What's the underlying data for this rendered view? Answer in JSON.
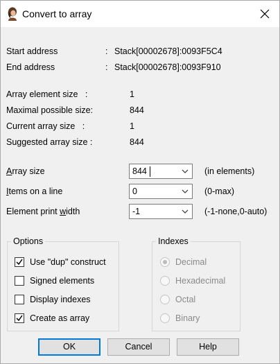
{
  "window": {
    "title": "Convert to array",
    "close_glyph": "✕"
  },
  "addresses": [
    {
      "label": "Start address",
      "sep": ":",
      "value": "Stack[00002678]:0093F5C4"
    },
    {
      "label": "End address",
      "sep": ":",
      "value": "Stack[00002678]:0093F910"
    }
  ],
  "info": [
    {
      "label": "Array element size   :",
      "value": "1"
    },
    {
      "label": "Maximal possible size:",
      "value": "844"
    },
    {
      "label": "Current array size   :",
      "value": "1"
    },
    {
      "label": "Suggested array size :",
      "value": "844"
    }
  ],
  "fields": {
    "array_size": {
      "label_accel": "A",
      "label_rest": "rray size",
      "value": "844",
      "hint": "(in elements)"
    },
    "items_on_line": {
      "label_accel": "I",
      "label_rest": "tems on a line",
      "value": "0",
      "hint": "(0-max)"
    },
    "print_width": {
      "label_pre": "Element print ",
      "label_accel": "w",
      "label_rest": "idth",
      "value": "-1",
      "hint": "(-1-none,0-auto)"
    }
  },
  "options": {
    "title": "Options",
    "items": [
      {
        "label": "Use \"dup\" construct",
        "checked": true
      },
      {
        "label": "Signed elements",
        "checked": false
      },
      {
        "label": "Display indexes",
        "checked": false
      },
      {
        "label": "Create as array",
        "checked": true
      }
    ]
  },
  "indexes": {
    "title": "Indexes",
    "items": [
      {
        "label": "Decimal",
        "selected": true
      },
      {
        "label": "Hexadecimal",
        "selected": false
      },
      {
        "label": "Octal",
        "selected": false
      },
      {
        "label": "Binary",
        "selected": false
      }
    ]
  },
  "buttons": {
    "ok": "OK",
    "cancel": "Cancel",
    "help": "Help"
  }
}
